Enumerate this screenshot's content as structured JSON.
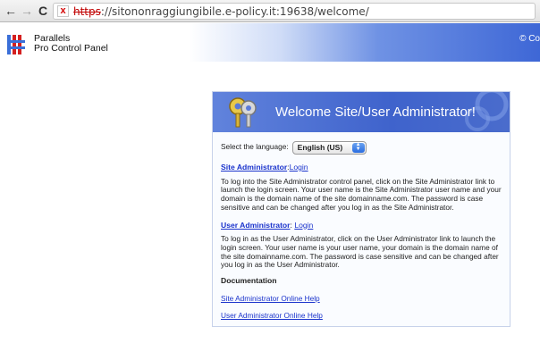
{
  "browser": {
    "url_scheme": "https",
    "url_rest": "://sitononraggiungibile.e-policy.it:19638/welcome/",
    "back_glyph": "←",
    "forward_glyph": "→",
    "reload_glyph": "C",
    "security_glyph": "x"
  },
  "header": {
    "logo_line1": "Parallels",
    "logo_line2": "Pro Control Panel",
    "copyright": "© Co"
  },
  "panel": {
    "title": "Welcome Site/User Administrator!",
    "language_label": "Select the language:",
    "language_value": "English (US)",
    "site_admin": {
      "heading": "Site Administrator",
      "separator": ":",
      "login": "Login",
      "description": "To log into the Site Administrator control panel, click on the Site Administrator link to launch the login screen. Your user name is the Site Administrator user name and your domain is the domain name of the site domainname.com. The password is case sensitive and can be changed after you log in as the Site Administrator."
    },
    "user_admin": {
      "heading": "User Administrator",
      "separator": ": ",
      "login": "Login",
      "description": "To log in as the User Administrator, click on the User Administrator link to launch the login screen. Your user name is your user name, your domain is the domain name of the site domainname.com. The password is case sensitive and can be changed after you log in as the User Administrator."
    },
    "documentation": {
      "heading": "Documentation",
      "links": [
        "Site Administrator Online Help",
        "User Administrator Online Help"
      ]
    }
  },
  "colors": {
    "banner": "#3f63cc",
    "link": "#1a33cc",
    "header_gradient_end": "#3e67d6"
  }
}
